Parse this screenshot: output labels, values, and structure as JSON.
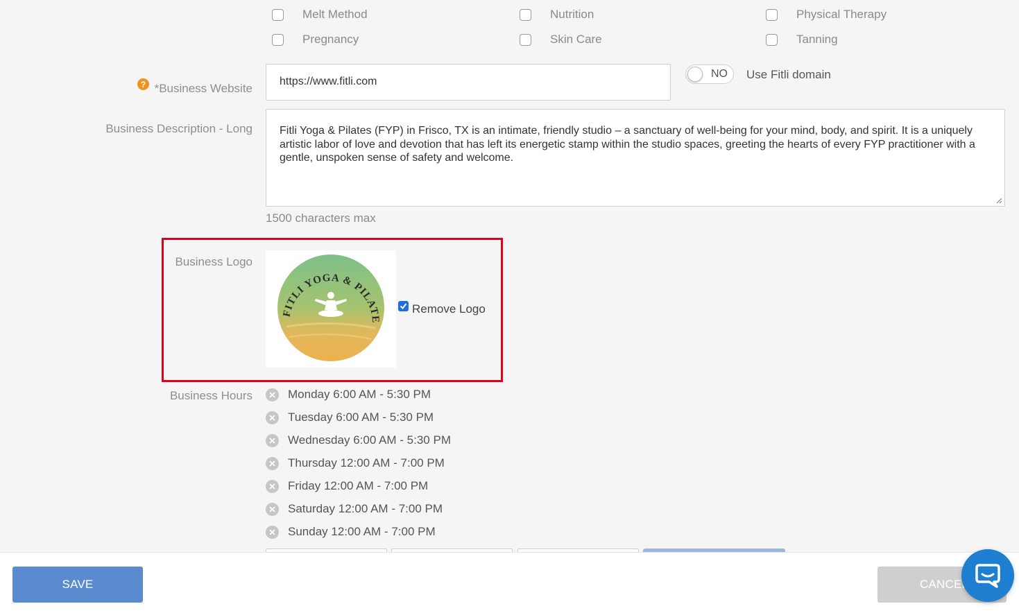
{
  "categories": {
    "row1": [
      "Melt Method",
      "Nutrition",
      "Physical Therapy"
    ],
    "row2": [
      "Pregnancy",
      "Skin Care",
      "Tanning"
    ]
  },
  "website": {
    "label": "*Business Website",
    "value": "https://www.fitli.com",
    "toggle_state": "NO",
    "toggle_label": "Use Fitli domain"
  },
  "description": {
    "label": "Business Description - Long",
    "value": "Fitli Yoga & Pilates (FYP) in Frisco, TX  is an intimate, friendly studio – a sanctuary of well-being for your mind, body, and spirit.  It is a uniquely artistic labor of love and devotion that has left its energetic stamp within the studio spaces, greeting the hearts of every FYP practitioner with a gentle, unspoken sense of safety and welcome.",
    "hint": "1500 characters max"
  },
  "logo": {
    "label": "Business Logo",
    "logo_text": "FITLI YOGA & PILATES",
    "remove_label": "Remove Logo",
    "remove_checked": true
  },
  "hours": {
    "label": "Business Hours",
    "items": [
      "Monday 6:00 AM - 5:30 PM",
      "Tuesday 6:00 AM - 5:30 PM",
      "Wednesday 6:00 AM - 5:30 PM",
      "Thursday 12:00 AM - 7:00 PM",
      "Friday 12:00 AM - 7:00 PM",
      "Saturday 12:00 AM - 7:00 PM",
      "Sunday 12:00 AM - 7:00 PM"
    ]
  },
  "footer": {
    "save_label": "SAVE",
    "cancel_label": "CANCEL"
  },
  "colors": {
    "primary": "#5b8bcf",
    "highlight": "#e0001a",
    "help": "#f0931e",
    "chat": "#1e7fd0"
  }
}
